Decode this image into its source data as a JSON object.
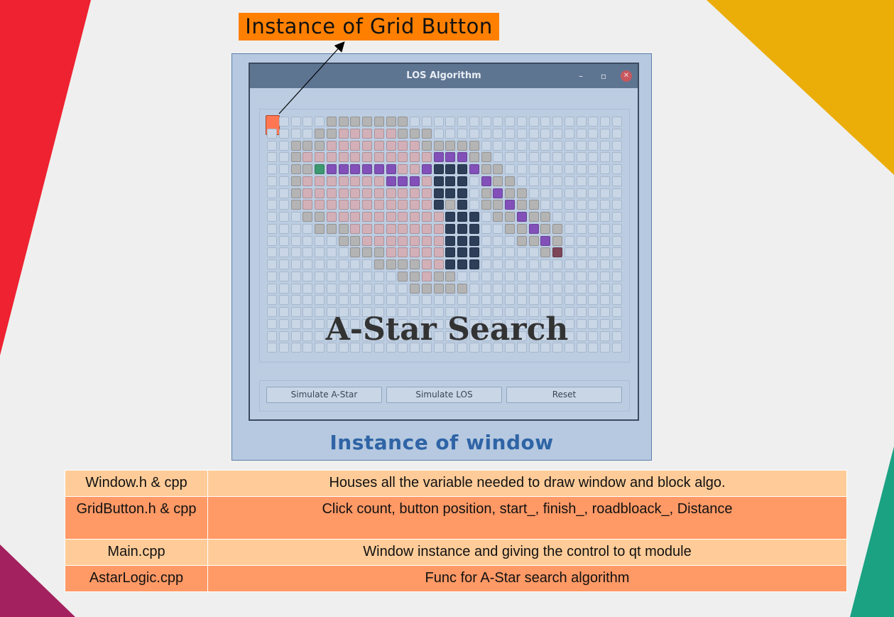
{
  "callout": {
    "label": "Instance of Grid Button"
  },
  "window": {
    "title": "LOS Algorithm",
    "controls": {
      "minimize": "–",
      "maximize": "▫",
      "close": "✕"
    },
    "grid": {
      "columns": 30,
      "rows": 20,
      "selected_cell": [
        0,
        0
      ],
      "legend": {
        "empty": "#c9d6e6",
        "gray": "#b4b4b4",
        "pink": "#d3b0b8",
        "purple": "#8250b8",
        "navy": "#2d3e58",
        "start": "#3c9870",
        "finish": "#7c4658",
        "selected": "#ff7752"
      },
      "cells": {
        "gray": [
          [
            5,
            0
          ],
          [
            6,
            0
          ],
          [
            7,
            0
          ],
          [
            8,
            0
          ],
          [
            9,
            0
          ],
          [
            10,
            0
          ],
          [
            11,
            0
          ],
          [
            4,
            1
          ],
          [
            5,
            1
          ],
          [
            11,
            1
          ],
          [
            12,
            1
          ],
          [
            13,
            1
          ],
          [
            2,
            2
          ],
          [
            3,
            2
          ],
          [
            4,
            2
          ],
          [
            13,
            2
          ],
          [
            14,
            2
          ],
          [
            15,
            2
          ],
          [
            16,
            2
          ],
          [
            17,
            2
          ],
          [
            2,
            3
          ],
          [
            3,
            3
          ],
          [
            17,
            3
          ],
          [
            18,
            3
          ],
          [
            2,
            4
          ],
          [
            3,
            4
          ],
          [
            18,
            4
          ],
          [
            19,
            4
          ],
          [
            2,
            5
          ],
          [
            19,
            5
          ],
          [
            20,
            5
          ],
          [
            2,
            6
          ],
          [
            18,
            6
          ],
          [
            20,
            6
          ],
          [
            21,
            6
          ],
          [
            2,
            7
          ],
          [
            15,
            7
          ],
          [
            18,
            7
          ],
          [
            19,
            7
          ],
          [
            21,
            7
          ],
          [
            22,
            7
          ],
          [
            3,
            8
          ],
          [
            4,
            8
          ],
          [
            19,
            8
          ],
          [
            20,
            8
          ],
          [
            22,
            8
          ],
          [
            23,
            8
          ],
          [
            4,
            9
          ],
          [
            5,
            9
          ],
          [
            6,
            9
          ],
          [
            20,
            9
          ],
          [
            21,
            9
          ],
          [
            23,
            9
          ],
          [
            24,
            9
          ],
          [
            6,
            10
          ],
          [
            7,
            10
          ],
          [
            21,
            10
          ],
          [
            22,
            10
          ],
          [
            24,
            10
          ],
          [
            7,
            11
          ],
          [
            8,
            11
          ],
          [
            9,
            11
          ],
          [
            23,
            11
          ],
          [
            9,
            12
          ],
          [
            10,
            12
          ],
          [
            11,
            12
          ],
          [
            12,
            12
          ],
          [
            15,
            12
          ],
          [
            11,
            13
          ],
          [
            12,
            13
          ],
          [
            14,
            13
          ],
          [
            15,
            13
          ],
          [
            12,
            14
          ],
          [
            13,
            14
          ],
          [
            14,
            14
          ],
          [
            15,
            14
          ],
          [
            16,
            14
          ]
        ],
        "pink": [
          [
            6,
            1
          ],
          [
            7,
            1
          ],
          [
            8,
            1
          ],
          [
            9,
            1
          ],
          [
            10,
            1
          ],
          [
            5,
            2
          ],
          [
            6,
            2
          ],
          [
            7,
            2
          ],
          [
            8,
            2
          ],
          [
            9,
            2
          ],
          [
            10,
            2
          ],
          [
            11,
            2
          ],
          [
            12,
            2
          ],
          [
            3,
            3
          ],
          [
            4,
            3
          ],
          [
            5,
            3
          ],
          [
            6,
            3
          ],
          [
            7,
            3
          ],
          [
            8,
            3
          ],
          [
            9,
            3
          ],
          [
            10,
            3
          ],
          [
            11,
            3
          ],
          [
            12,
            3
          ],
          [
            13,
            3
          ],
          [
            4,
            4
          ],
          [
            11,
            4
          ],
          [
            12,
            4
          ],
          [
            3,
            5
          ],
          [
            4,
            5
          ],
          [
            5,
            5
          ],
          [
            6,
            5
          ],
          [
            7,
            5
          ],
          [
            8,
            5
          ],
          [
            9,
            5
          ],
          [
            13,
            5
          ],
          [
            3,
            6
          ],
          [
            4,
            6
          ],
          [
            5,
            6
          ],
          [
            6,
            6
          ],
          [
            7,
            6
          ],
          [
            8,
            6
          ],
          [
            9,
            6
          ],
          [
            10,
            6
          ],
          [
            11,
            6
          ],
          [
            12,
            6
          ],
          [
            13,
            6
          ],
          [
            3,
            7
          ],
          [
            4,
            7
          ],
          [
            5,
            7
          ],
          [
            6,
            7
          ],
          [
            7,
            7
          ],
          [
            8,
            7
          ],
          [
            9,
            7
          ],
          [
            10,
            7
          ],
          [
            11,
            7
          ],
          [
            12,
            7
          ],
          [
            13,
            7
          ],
          [
            5,
            8
          ],
          [
            6,
            8
          ],
          [
            7,
            8
          ],
          [
            8,
            8
          ],
          [
            9,
            8
          ],
          [
            10,
            8
          ],
          [
            11,
            8
          ],
          [
            12,
            8
          ],
          [
            13,
            8
          ],
          [
            14,
            8
          ],
          [
            7,
            9
          ],
          [
            8,
            9
          ],
          [
            9,
            9
          ],
          [
            10,
            9
          ],
          [
            11,
            9
          ],
          [
            12,
            9
          ],
          [
            13,
            9
          ],
          [
            14,
            9
          ],
          [
            8,
            10
          ],
          [
            9,
            10
          ],
          [
            10,
            10
          ],
          [
            11,
            10
          ],
          [
            12,
            10
          ],
          [
            13,
            10
          ],
          [
            14,
            10
          ],
          [
            10,
            11
          ],
          [
            11,
            11
          ],
          [
            12,
            11
          ],
          [
            13,
            11
          ],
          [
            14,
            11
          ],
          [
            13,
            12
          ],
          [
            14,
            12
          ],
          [
            13,
            13
          ]
        ],
        "purple": [
          [
            5,
            4
          ],
          [
            6,
            4
          ],
          [
            7,
            4
          ],
          [
            8,
            4
          ],
          [
            9,
            4
          ],
          [
            10,
            4
          ],
          [
            13,
            4
          ],
          [
            14,
            3
          ],
          [
            15,
            3
          ],
          [
            16,
            3
          ],
          [
            17,
            4
          ],
          [
            10,
            5
          ],
          [
            11,
            5
          ],
          [
            12,
            5
          ],
          [
            18,
            5
          ],
          [
            19,
            6
          ],
          [
            20,
            7
          ],
          [
            21,
            8
          ],
          [
            22,
            9
          ],
          [
            23,
            10
          ]
        ],
        "navy": [
          [
            14,
            4
          ],
          [
            15,
            4
          ],
          [
            16,
            4
          ],
          [
            14,
            5
          ],
          [
            15,
            5
          ],
          [
            16,
            5
          ],
          [
            14,
            6
          ],
          [
            15,
            6
          ],
          [
            16,
            6
          ],
          [
            14,
            7
          ],
          [
            16,
            7
          ],
          [
            15,
            8
          ],
          [
            16,
            8
          ],
          [
            17,
            8
          ],
          [
            15,
            9
          ],
          [
            16,
            9
          ],
          [
            17,
            9
          ],
          [
            15,
            10
          ],
          [
            16,
            10
          ],
          [
            17,
            10
          ],
          [
            15,
            11
          ],
          [
            16,
            11
          ],
          [
            17,
            11
          ],
          [
            15,
            12
          ],
          [
            16,
            12
          ],
          [
            17,
            12
          ]
        ],
        "start": [
          [
            4,
            4
          ]
        ],
        "finish": [
          [
            24,
            11
          ]
        ]
      }
    },
    "buttons": {
      "simulate_astar": "Simulate A-Star",
      "simulate_los": "Simulate LOS",
      "reset": "Reset"
    }
  },
  "overlay_title": "A-Star  Search",
  "window_label": "Instance of window",
  "table": {
    "rows": [
      {
        "file": "Window.h & cpp",
        "description": "Houses all the variable needed to draw window and block algo."
      },
      {
        "file": "GridButton.h & cpp",
        "description": "Click count, button position, start_, finish_, roadbloack_, Distance"
      },
      {
        "file": "Main.cpp",
        "description": "Window instance and giving the control to qt module"
      },
      {
        "file": "AstarLogic.cpp",
        "description": "Func for A-Star search algorithm"
      }
    ]
  },
  "colors": {
    "callout_bg": "#ff8000",
    "accent_blue": "#2f64a6",
    "deco_red": "#ee2230",
    "deco_yellow": "#ebad08",
    "deco_teal": "#1aa283",
    "deco_purple": "#a3215e",
    "table_light": "#ffcc99",
    "table_dark": "#ff9966"
  }
}
